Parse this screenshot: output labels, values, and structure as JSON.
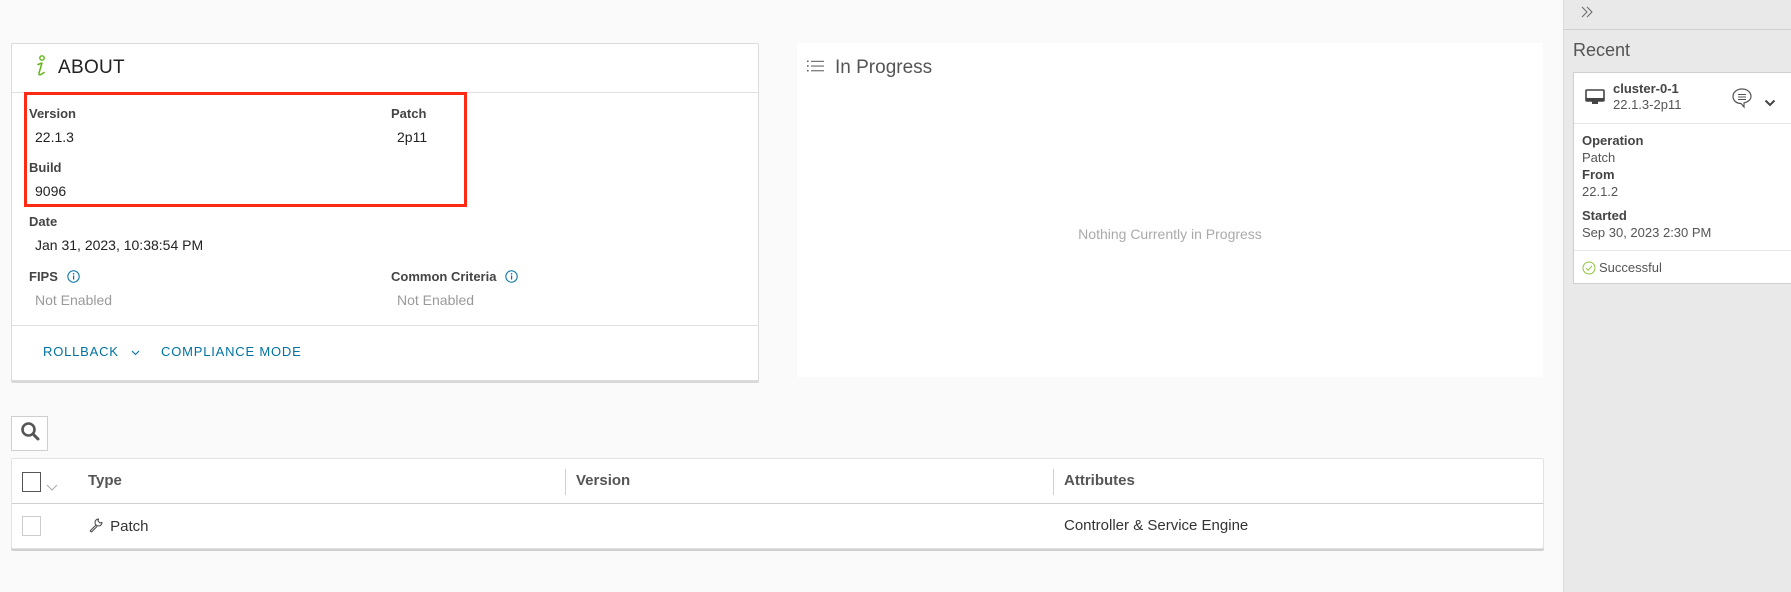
{
  "about": {
    "title": "ABOUT",
    "icon": "info-italic-icon",
    "fields": {
      "version_label": "Version",
      "version_value": "22.1.3",
      "patch_label": "Patch",
      "patch_value": "2p11",
      "build_label": "Build",
      "build_value": "9096",
      "date_label": "Date",
      "date_value": "Jan 31, 2023, 10:38:54 PM",
      "fips_label": "FIPS",
      "fips_value": "Not Enabled",
      "cc_label": "Common Criteria",
      "cc_value": "Not Enabled"
    },
    "actions": {
      "rollback": "ROLLBACK",
      "compliance": "COMPLIANCE MODE"
    },
    "highlight_color": "#ff2a14"
  },
  "in_progress": {
    "title": "In Progress",
    "icon": "list-icon",
    "empty_text": "Nothing Currently in Progress"
  },
  "grid": {
    "columns": [
      "Type",
      "Version",
      "Attributes"
    ],
    "rows": [
      {
        "type": "Patch",
        "type_icon": "wrench-icon",
        "version": "",
        "attributes": "Controller & Service Engine"
      }
    ]
  },
  "sidebar": {
    "collapse_icon": "double-chevron-right-icon",
    "title": "Recent",
    "card": {
      "name": "cluster-0-1",
      "version": "22.1.3-2p11",
      "operation_label": "Operation",
      "operation_value": "Patch",
      "from_label": "From",
      "from_value": "22.1.2",
      "started_label": "Started",
      "started_value": "Sep 30, 2023 2:30 PM",
      "status": "Successful",
      "status_color": "#8cc63f"
    }
  },
  "colors": {
    "link": "#0072a3",
    "accent_green": "#60b515"
  }
}
